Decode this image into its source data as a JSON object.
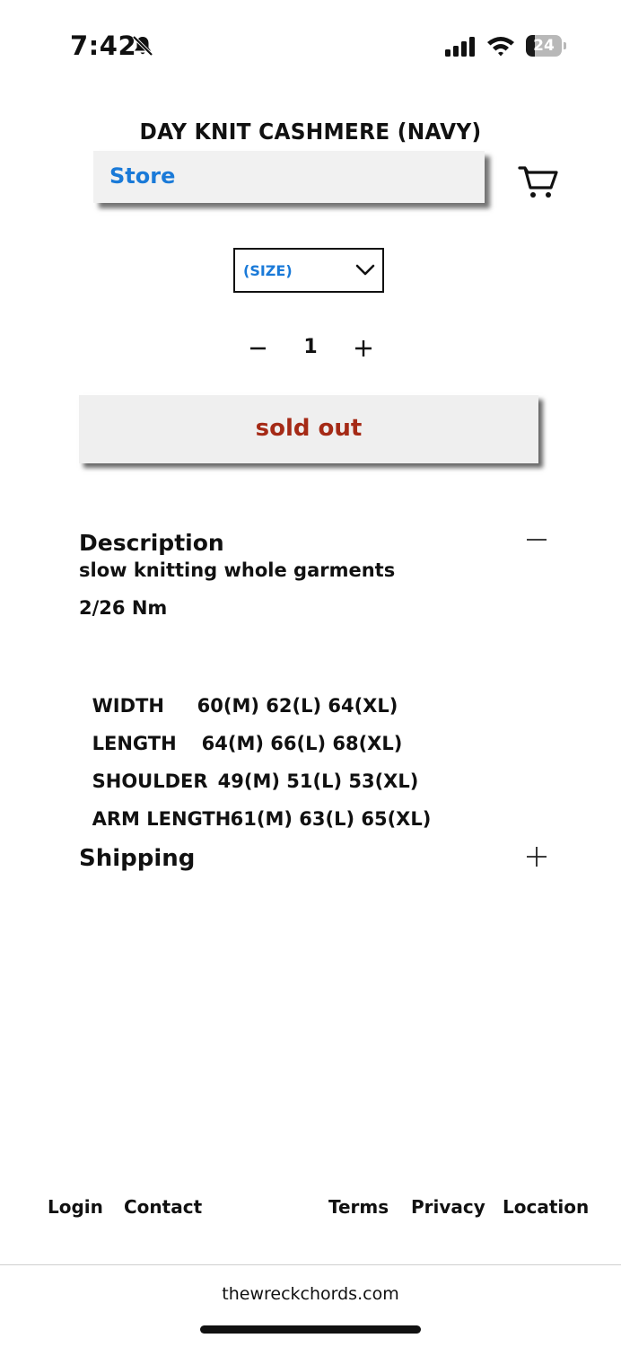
{
  "status_bar": {
    "time": "7:42",
    "battery_level": "24",
    "battery_percent": 24
  },
  "header": {
    "product_title": "DAY KNIT CASHMERE (NAVY)",
    "store_label": "Store"
  },
  "product": {
    "size_select_value": "(SIZE)",
    "quantity": "1",
    "sold_out_label": "sold out"
  },
  "description": {
    "heading": "Description",
    "lines": [
      "slow knitting whole garments",
      "2/26 Nm"
    ],
    "specs": [
      {
        "label": "WIDTH",
        "value": "60(M) 62(L) 64(XL)"
      },
      {
        "label": "LENGTH",
        "value": "64(M) 66(L) 68(XL)"
      },
      {
        "label": "SHOULDER",
        "value": "49(M) 51(L) 53(XL)"
      },
      {
        "label": "ARM LENGTH",
        "value": "61(M) 63(L) 65(XL)"
      }
    ]
  },
  "shipping": {
    "heading": "Shipping"
  },
  "footer": {
    "links": [
      "Login",
      "Contact",
      "Terms",
      "Privacy",
      "Location"
    ]
  },
  "browser": {
    "url": "thewreckchords.com"
  },
  "colors": {
    "link_blue": "#1a7ad8",
    "sold_out_red": "#a52a16"
  }
}
